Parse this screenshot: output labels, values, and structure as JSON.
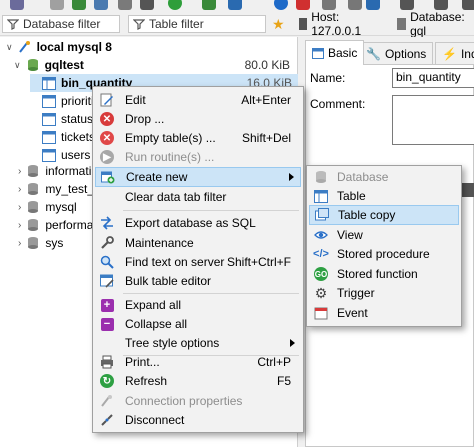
{
  "filters": {
    "database_placeholder": "Database filter",
    "table_placeholder": "Table filter"
  },
  "host": {
    "label": "Host: 127.0.0.1",
    "database_label": "Database: gql"
  },
  "tree": {
    "root": "local mysql 8",
    "database": "gqltest",
    "database_size": "80.0 KiB",
    "selected_table": "bin_quantity",
    "selected_size": "16.0 KiB",
    "tables": [
      "prioritie",
      "status",
      "tickets",
      "users"
    ],
    "other_databases": [
      "informati",
      "my_test_d",
      "mysql",
      "performa",
      "sys"
    ]
  },
  "right_panel": {
    "tabs": [
      "Basic",
      "Options",
      "Index"
    ],
    "name_label": "Name:",
    "name_value": "bin_quantity",
    "comment_label": "Comment:"
  },
  "context_menu": {
    "items": [
      {
        "label": "Edit",
        "shortcut": "Alt+Enter",
        "icon": "edit-icon"
      },
      {
        "label": "Drop ...",
        "shortcut": "",
        "icon": "drop-icon"
      },
      {
        "label": "Empty table(s) ...",
        "shortcut": "Shift+Del",
        "icon": "empty-icon"
      },
      {
        "label": "Run routine(s) ...",
        "shortcut": "",
        "icon": "run-icon",
        "disabled": true
      },
      {
        "label": "Create new",
        "shortcut": "",
        "icon": "create-icon",
        "submenu": true
      },
      {
        "label": "Clear data tab filter",
        "shortcut": "",
        "icon": ""
      },
      {
        "label": "Export database as SQL",
        "shortcut": "",
        "icon": "export-icon"
      },
      {
        "label": "Maintenance",
        "shortcut": "",
        "icon": "wrench-icon"
      },
      {
        "label": "Find text on server",
        "shortcut": "Shift+Ctrl+F",
        "icon": "search-icon"
      },
      {
        "label": "Bulk table editor",
        "shortcut": "",
        "icon": "table-edit-icon"
      },
      {
        "label": "Expand all",
        "shortcut": "",
        "icon": "expand-icon"
      },
      {
        "label": "Collapse all",
        "shortcut": "",
        "icon": "collapse-icon"
      },
      {
        "label": "Tree style options",
        "shortcut": "",
        "icon": "",
        "submenu": true
      },
      {
        "label": "Print...",
        "shortcut": "Ctrl+P",
        "icon": "print-icon"
      },
      {
        "label": "Refresh",
        "shortcut": "F5",
        "icon": "refresh-icon"
      },
      {
        "label": "Connection properties",
        "shortcut": "",
        "icon": "properties-icon",
        "disabled": true
      },
      {
        "label": "Disconnect",
        "shortcut": "",
        "icon": "disconnect-icon"
      }
    ]
  },
  "submenu": {
    "items": [
      {
        "label": "Database",
        "disabled": true
      },
      {
        "label": "Table"
      },
      {
        "label": "Table copy"
      },
      {
        "label": "View"
      },
      {
        "label": "Stored procedure"
      },
      {
        "label": "Stored function"
      },
      {
        "label": "Trigger"
      },
      {
        "label": "Event"
      }
    ]
  },
  "colors": {
    "highlight": "#cce4f7",
    "highlight_border": "#99c9ef",
    "accent": "#0078d7"
  }
}
